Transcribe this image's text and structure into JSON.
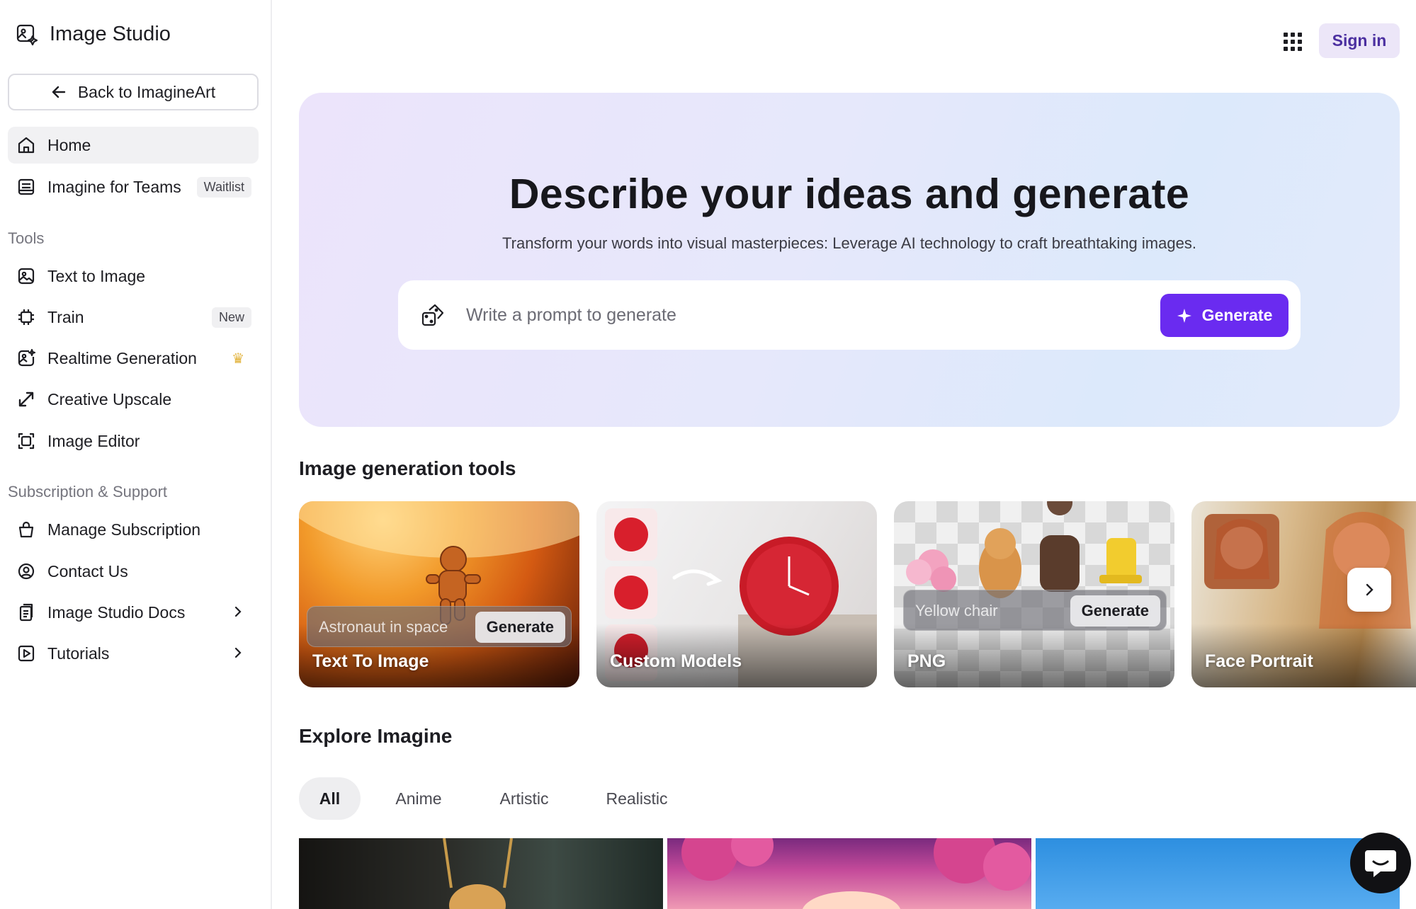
{
  "brand": {
    "title": "Image Studio"
  },
  "back": {
    "label": "Back to ImagineArt"
  },
  "nav": {
    "home": "Home",
    "teams": "Imagine for Teams",
    "teams_badge": "Waitlist"
  },
  "tools_section": {
    "label": "Tools",
    "items": [
      {
        "label": "Text to Image",
        "icon": "image-icon"
      },
      {
        "label": "Train",
        "icon": "chip-icon",
        "badge": "New"
      },
      {
        "label": "Realtime Generation",
        "icon": "realtime-image-icon",
        "badge_icon": "crown-icon"
      },
      {
        "label": "Creative Upscale",
        "icon": "expand-arrows-icon"
      },
      {
        "label": "Image Editor",
        "icon": "editor-frame-icon"
      }
    ]
  },
  "support_section": {
    "label": "Subscription & Support",
    "items": [
      {
        "label": "Manage Subscription",
        "icon": "bag-icon"
      },
      {
        "label": "Contact Us",
        "icon": "contact-icon"
      },
      {
        "label": "Image Studio Docs",
        "icon": "docs-icon"
      },
      {
        "label": "Tutorials",
        "icon": "play-icon"
      }
    ]
  },
  "header": {
    "signin": "Sign in"
  },
  "hero": {
    "title": "Describe your ideas and generate",
    "subtitle": "Transform your words into visual masterpieces: Leverage AI technology to craft breathtaking images.",
    "placeholder": "Write a prompt to generate",
    "generate": "Generate"
  },
  "tools_heading": "Image generation tools",
  "cards": [
    {
      "label": "Text To Image",
      "pill_text": "Astronaut in space",
      "pill_button": "Generate"
    },
    {
      "label": "Custom Models"
    },
    {
      "label": "PNG",
      "pill_text": "Yellow chair",
      "pill_button": "Generate"
    },
    {
      "label": "Face Portrait"
    }
  ],
  "explore": {
    "heading": "Explore Imagine",
    "tabs": [
      "All",
      "Anime",
      "Artistic",
      "Realistic"
    ]
  },
  "colors": {
    "accent": "#6a2bf0",
    "signin_bg": "#ece6f8",
    "signin_text": "#4b2fa0"
  }
}
